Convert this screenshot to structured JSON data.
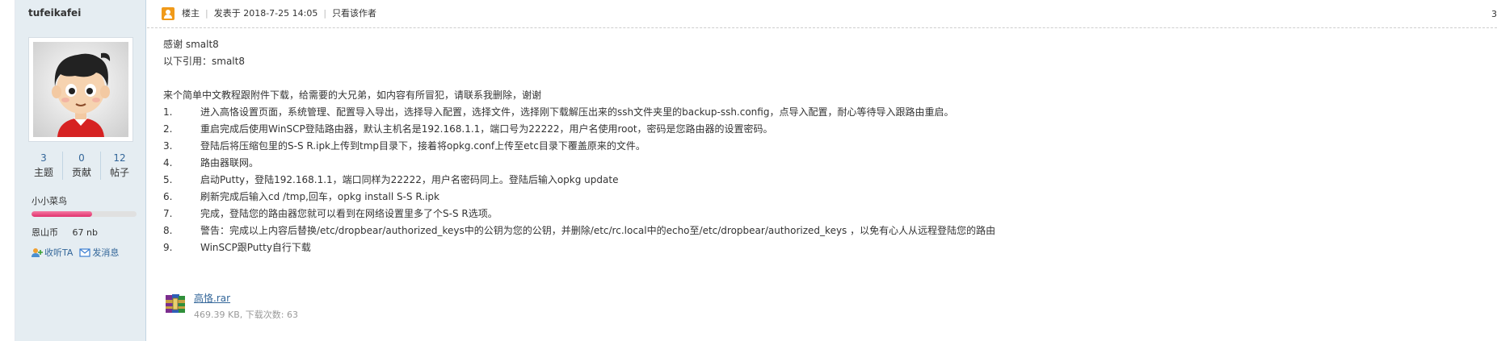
{
  "author": {
    "username": "tufeikafei",
    "stats": [
      {
        "value": "3",
        "label": "主题"
      },
      {
        "value": "0",
        "label": "贡献"
      },
      {
        "value": "12",
        "label": "帖子"
      }
    ],
    "rank": "小小菜鸟",
    "rank_progress_percent": 58,
    "coins_label": "恩山币",
    "coins_value": "67 nb",
    "follow_label": "收听TA",
    "message_label": "发消息"
  },
  "header": {
    "floor_label": "楼主",
    "posted_at": "发表于 2018-7-25 14:05",
    "only_author_label": "只看该作者",
    "floor_number": "3"
  },
  "post": {
    "lines": [
      "感谢   smalt8",
      "以下引用：smalt8",
      "",
      "来个简单中文教程跟附件下载，给需要的大兄弟，如内容有所冒犯，请联系我删除，谢谢"
    ],
    "steps": [
      {
        "num": "1.",
        "text": "进入高恪设置页面，系统管理、配置导入导出，选择导入配置，选择文件，选择刚下载解压出来的ssh文件夹里的backup-ssh.config，点导入配置，耐心等待导入跟路由重启。"
      },
      {
        "num": "2.",
        "text": "重启完成后使用WinSCP登陆路由器，默认主机名是192.168.1.1，端口号为22222，用户名使用root，密码是您路由器的设置密码。"
      },
      {
        "num": "3.",
        "text": "登陆后将压缩包里的S-S R.ipk上传到tmp目录下，接着将opkg.conf上传至etc目录下覆盖原来的文件。"
      },
      {
        "num": "4.",
        "text": "路由器联网。"
      },
      {
        "num": "5.",
        "text": "启动Putty，登陆192.168.1.1，端口同样为22222，用户名密码同上。登陆后输入opkg update"
      },
      {
        "num": "6.",
        "text": "刷新完成后输入cd /tmp,回车，opkg install S-S R.ipk"
      },
      {
        "num": "7.",
        "text": "完成，登陆您的路由器您就可以看到在网络设置里多了个S-S R选项。"
      },
      {
        "num": "8.",
        "text": "警告：完成以上内容后替换/etc/dropbear/authorized_keys中的公钥为您的公钥，并删除/etc/rc.local中的echo至/etc/dropbear/authorized_keys ，以免有心人从远程登陆您的路由"
      },
      {
        "num": "9.",
        "text": "WinSCP跟Putty自行下载"
      }
    ]
  },
  "attachment": {
    "name": "高恪.rar",
    "meta": "469.39 KB, 下载次数: 63"
  }
}
